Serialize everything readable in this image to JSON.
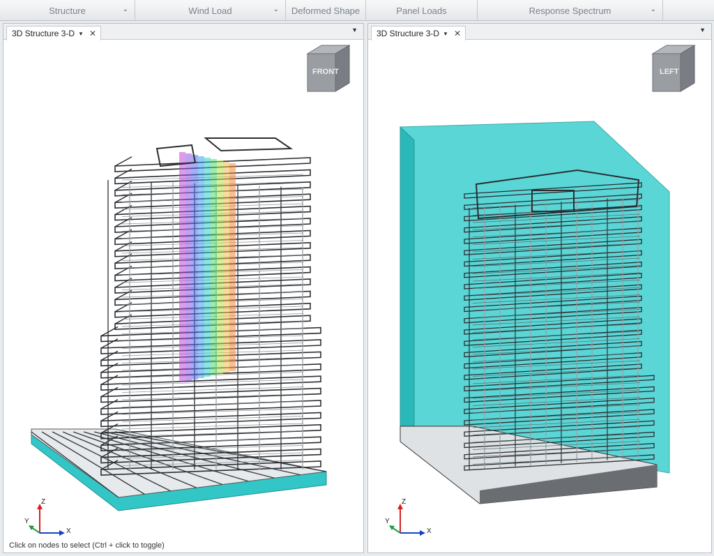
{
  "toolbar": {
    "items": [
      {
        "label": "Structure",
        "has_dropdown": true
      },
      {
        "label": "Wind Load",
        "has_dropdown": true
      },
      {
        "label": "Deformed Shape",
        "has_dropdown": false
      },
      {
        "label": "Panel Loads",
        "has_dropdown": false
      },
      {
        "label": "Response Spectrum",
        "has_dropdown": true
      }
    ]
  },
  "panes": [
    {
      "tab_label": "3D Structure 3-D",
      "view_cube_label": "FRONT",
      "axis_labels": {
        "z": "Z",
        "y": "Y",
        "x": "X"
      }
    },
    {
      "tab_label": "3D Structure 3-D",
      "view_cube_label": "LEFT",
      "axis_labels": {
        "z": "Z",
        "y": "Y",
        "x": "X"
      }
    }
  ],
  "status_text": "Click on nodes to select (Ctrl + click to toggle)",
  "colors": {
    "slab_cyan": "#33c6c6",
    "bounding_box_cyan": "#3fd0d0",
    "frame_dark": "#2a2d31",
    "frame_light": "#9aa0a6",
    "cube_grey": "#8c9096"
  }
}
